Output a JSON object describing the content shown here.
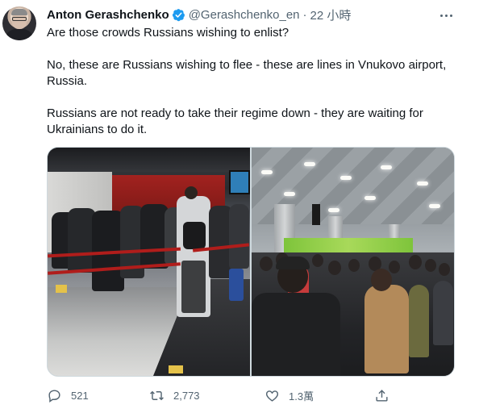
{
  "tweet": {
    "author_name": "Anton Gerashchenko",
    "handle": "@Gerashchenko_en",
    "separator": "·",
    "time": "22 小時",
    "text": {
      "line1": "Are those crowds Russians wishing to enlist?",
      "line2": "No, these are Russians wishing to flee - these are lines in Vnukovo airport, Russia.",
      "line3": "Russians are not ready to take their regime down - they are waiting for Ukrainians to do it."
    },
    "verified_color": "#1d9bf0"
  },
  "actions": {
    "reply_count": "521",
    "retweet_count": "2,773",
    "like_count": "1.3萬",
    "icons": [
      "reply-icon",
      "retweet-icon",
      "like-icon",
      "share-icon"
    ]
  },
  "colors": {
    "text_primary": "#0f1419",
    "text_secondary": "#536471",
    "border": "#cfd9de"
  }
}
